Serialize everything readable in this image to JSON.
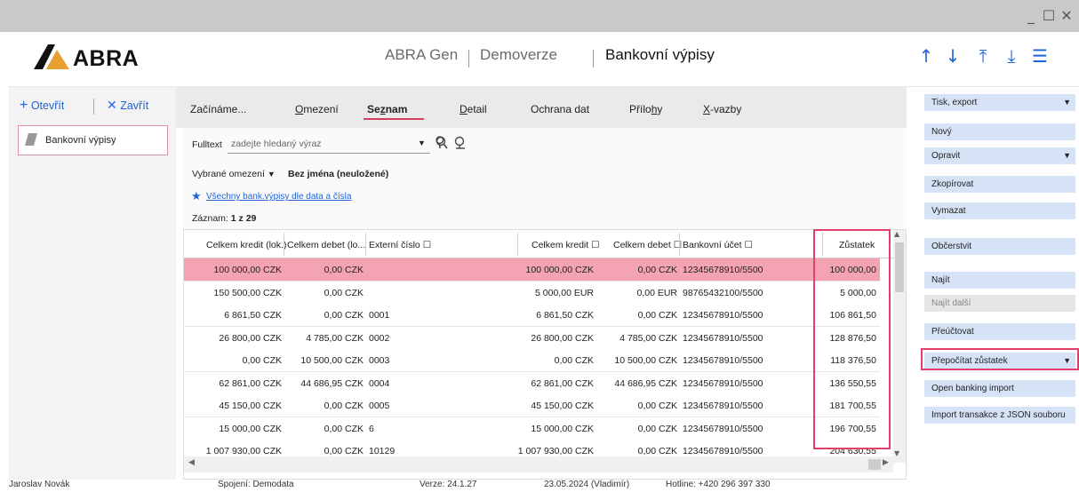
{
  "window": {
    "minimize": "_",
    "maximize": "☐",
    "close": "✕"
  },
  "header": {
    "logo_text": "ABRA",
    "app": "ABRA Gen",
    "database": "Demoverze",
    "title": "Bankovní výpisy"
  },
  "left_panel": {
    "open_label": "Otevřít",
    "close_label": "Zavřít",
    "item_label": "Bankovní výpisy"
  },
  "tabs": [
    {
      "pre": "Začínáme",
      "u": "",
      "post": "..."
    },
    {
      "pre": "",
      "u": "O",
      "post": "mezení"
    },
    {
      "pre": "Se",
      "u": "z",
      "post": "nam"
    },
    {
      "pre": "",
      "u": "D",
      "post": "etail"
    },
    {
      "pre": "Ochrana dat",
      "u": "",
      "post": ""
    },
    {
      "pre": "Přílo",
      "u": "h",
      "post": "y"
    },
    {
      "pre": "",
      "u": "X",
      "post": "-vazby"
    }
  ],
  "filter": {
    "fulltext_label": "Fulltext",
    "fulltext_placeholder": "zadejte hledaný výraz",
    "restriction_dropdown": "Vybrané omezení",
    "restriction_name": "Bez jména (neuložené)",
    "favorite_link": "Všechny bank.výpisy dle data a čísla",
    "records_label": "Záznam:",
    "records_value": "1 z 29"
  },
  "grid": {
    "headers": {
      "kredit_lok": "Celkem kredit (lok.)",
      "debet_lok": "Celkem debet (lo...",
      "externi": "Externí číslo ☐",
      "kredit": "Celkem kredit ☐",
      "debet": "Celkem debet ☐",
      "ucet": "Bankovní účet ☐",
      "zustatek": "Zůstatek"
    },
    "rows": [
      {
        "kredit_lok": "100 000,00 CZK",
        "debet_lok": "0,00 CZK",
        "externi": "",
        "kredit": "100 000,00 CZK",
        "debet": "0,00 CZK",
        "ucet": "12345678910/5500",
        "zustatek": "100 000,00",
        "selected": true
      },
      {
        "kredit_lok": "150 500,00 CZK",
        "debet_lok": "0,00 CZK",
        "externi": "",
        "kredit": "5 000,00 EUR",
        "debet": "0,00 EUR",
        "ucet": "98765432100/5500",
        "zustatek": "5 000,00",
        "selected": false
      },
      {
        "kredit_lok": "6 861,50 CZK",
        "debet_lok": "0,00 CZK",
        "externi": "0001",
        "kredit": "6 861,50 CZK",
        "debet": "0,00 CZK",
        "ucet": "12345678910/5500",
        "zustatek": "106 861,50",
        "selected": false
      },
      {
        "kredit_lok": "26 800,00 CZK",
        "debet_lok": "4 785,00 CZK",
        "externi": "0002",
        "kredit": "26 800,00 CZK",
        "debet": "4 785,00 CZK",
        "ucet": "12345678910/5500",
        "zustatek": "128 876,50",
        "selected": false
      },
      {
        "kredit_lok": "0,00 CZK",
        "debet_lok": "10 500,00 CZK",
        "externi": "0003",
        "kredit": "0,00 CZK",
        "debet": "10 500,00 CZK",
        "ucet": "12345678910/5500",
        "zustatek": "118 376,50",
        "selected": false
      },
      {
        "kredit_lok": "62 861,00 CZK",
        "debet_lok": "44 686,95 CZK",
        "externi": "0004",
        "kredit": "62 861,00 CZK",
        "debet": "44 686,95 CZK",
        "ucet": "12345678910/5500",
        "zustatek": "136 550,55",
        "selected": false
      },
      {
        "kredit_lok": "45 150,00 CZK",
        "debet_lok": "0,00 CZK",
        "externi": "0005",
        "kredit": "45 150,00 CZK",
        "debet": "0,00 CZK",
        "ucet": "12345678910/5500",
        "zustatek": "181 700,55",
        "selected": false
      },
      {
        "kredit_lok": "15 000,00 CZK",
        "debet_lok": "0,00 CZK",
        "externi": "6",
        "kredit": "15 000,00 CZK",
        "debet": "0,00 CZK",
        "ucet": "12345678910/5500",
        "zustatek": "196 700,55",
        "selected": false
      },
      {
        "kredit_lok": "1 007 930,00 CZK",
        "debet_lok": "0,00 CZK",
        "externi": "10129",
        "kredit": "1 007 930,00 CZK",
        "debet": "0,00 CZK",
        "ucet": "12345678910/5500",
        "zustatek": "204 630,55",
        "selected": false
      }
    ]
  },
  "right_panel": {
    "buttons": [
      {
        "label": "Tisk, export",
        "dropdown": true,
        "disabled": false
      },
      {
        "label": "Nový",
        "dropdown": false,
        "disabled": false
      },
      {
        "label": "Opravit",
        "dropdown": true,
        "disabled": false
      },
      {
        "label": "Zkopírovat",
        "dropdown": false,
        "disabled": false
      },
      {
        "label": "Vymazat",
        "dropdown": false,
        "disabled": false
      },
      {
        "label": "Občerstvit",
        "dropdown": false,
        "disabled": false
      },
      {
        "label": "Najít",
        "dropdown": false,
        "disabled": false
      },
      {
        "label": "Najít další",
        "dropdown": false,
        "disabled": true
      },
      {
        "label": "Přeúčtovat",
        "dropdown": false,
        "disabled": false
      },
      {
        "label": "Přepočítat zůstatek",
        "dropdown": true,
        "disabled": false
      },
      {
        "label": "Open banking import",
        "dropdown": false,
        "disabled": false
      },
      {
        "label": "Import transakce z JSON souboru",
        "dropdown": false,
        "disabled": false
      }
    ]
  },
  "status_bar": {
    "user": "Jaroslav Novák",
    "connection": "Spojení: Demodata",
    "version": "Verze: 24.1.27",
    "date": "23.05.2024 (Vladimír)",
    "hotline": "Hotline: +420 296 397 330"
  },
  "colors": {
    "accent": "#1f63d6",
    "selected_row": "#f4a3b3",
    "highlight_border": "#e0406a",
    "button_bg": "#d6e3f7"
  }
}
